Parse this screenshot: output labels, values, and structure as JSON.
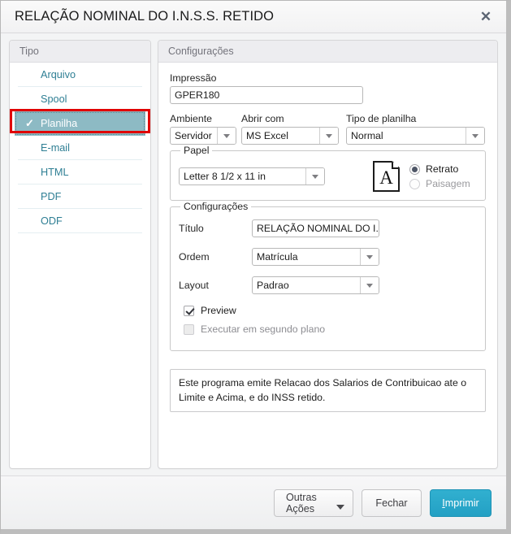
{
  "window": {
    "title": "RELAÇÃO NOMINAL DO I.N.S.S. RETIDO",
    "close_icon": "close-icon",
    "close_glyph": "✕"
  },
  "sidebar": {
    "header": "Tipo",
    "items": [
      {
        "label": "Arquivo",
        "selected": false
      },
      {
        "label": "Spool",
        "selected": false
      },
      {
        "label": "Planilha",
        "selected": true,
        "check_glyph": "✓"
      },
      {
        "label": "E-mail",
        "selected": false
      },
      {
        "label": "HTML",
        "selected": false
      },
      {
        "label": "PDF",
        "selected": false
      },
      {
        "label": "ODF",
        "selected": false
      }
    ],
    "highlight_color": "#e00000",
    "selected_bg": "#8dbac4",
    "link_color": "#2f7f94"
  },
  "settings_panel": {
    "header": "Configurações",
    "impressao": {
      "label": "Impressão",
      "value": "GPER180",
      "placeholder": ""
    },
    "ambiente": {
      "label": "Ambiente",
      "value": "Servidor"
    },
    "abrir_com": {
      "label": "Abrir com",
      "value": "MS Excel"
    },
    "tipo_planilha": {
      "label": "Tipo de planilha",
      "value": "Normal"
    },
    "papel": {
      "legend": "Papel",
      "size_value": "Letter 8 1/2 x 11 in",
      "page_icon_letter": "A",
      "orientation": {
        "retrato": "Retrato",
        "paisagem": "Paisagem",
        "selected": "Retrato"
      }
    },
    "configuracoes": {
      "legend": "Configurações",
      "titulo": {
        "label": "Título",
        "value": "RELAÇÃO NOMINAL DO I.N.S.S"
      },
      "ordem": {
        "label": "Ordem",
        "value": "Matrícula"
      },
      "layout": {
        "label": "Layout",
        "value": "Padrao"
      },
      "preview": {
        "label": "Preview",
        "checked": true
      },
      "segundo_plano": {
        "label": "Executar em segundo plano",
        "checked": false
      }
    },
    "description": "Este programa emite Relacao dos Salarios de Contribuicao ate o Limite e Acima, e do INSS retido."
  },
  "footer": {
    "outras_acoes": "Outras Ações",
    "fechar": "Fechar",
    "imprimir_accel": "I",
    "imprimir_rest": "mprimir",
    "primary_color": "#23a0c4"
  }
}
